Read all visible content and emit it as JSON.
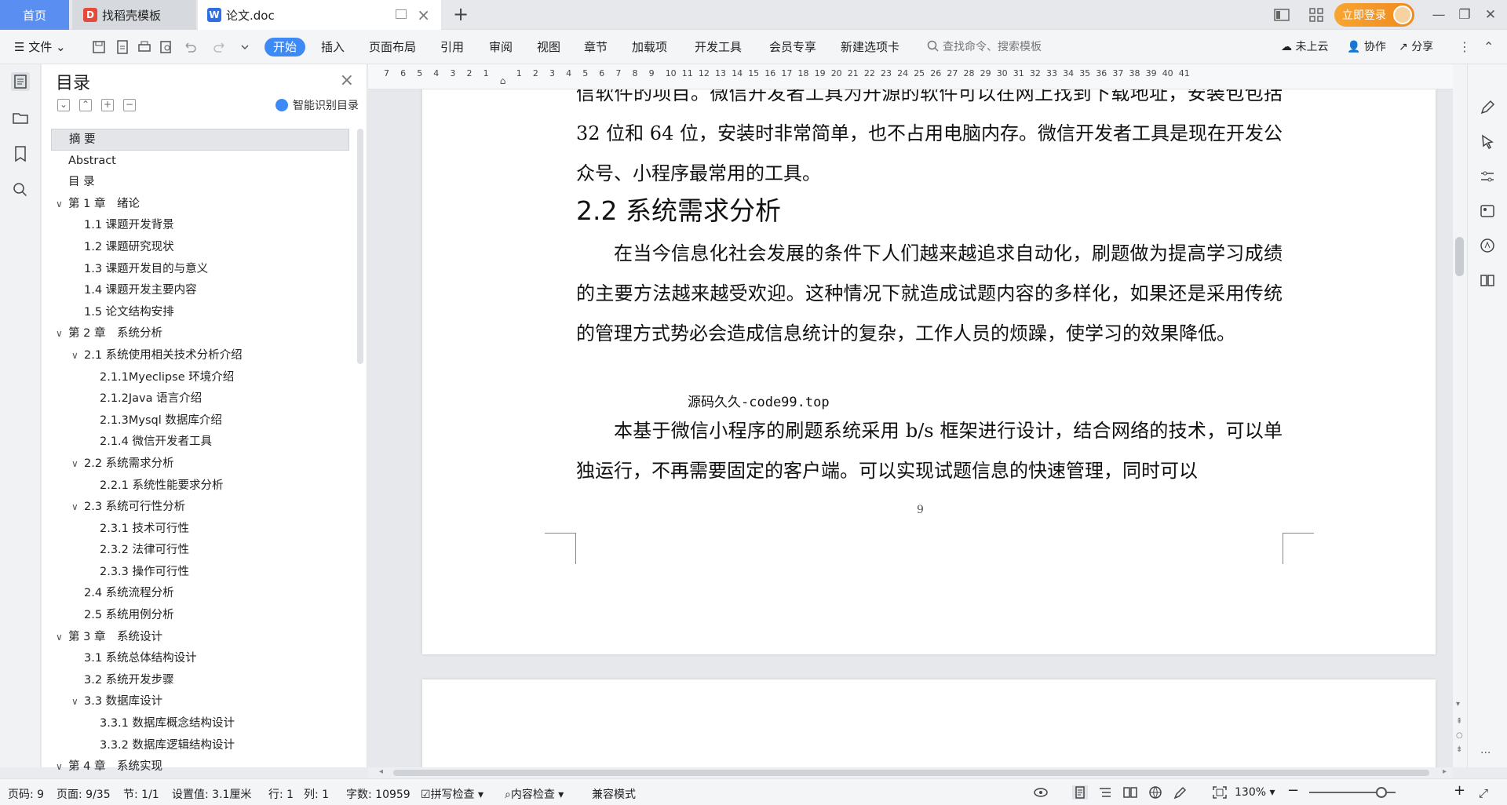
{
  "tabs": {
    "home": "首页",
    "template": "找稻壳模板",
    "doc": "论文.doc"
  },
  "titlebar": {
    "login_label": "立即登录"
  },
  "menubar": {
    "file": "文件",
    "items": [
      "开始",
      "插入",
      "页面布局",
      "引用",
      "审阅",
      "视图",
      "章节",
      "加载项",
      "开发工具",
      "会员专享",
      "新建选项卡"
    ],
    "search_placeholder": "查找命令、搜索模板",
    "cloud": "未上云",
    "collab": "协作",
    "share": "分享"
  },
  "toc": {
    "title": "目录",
    "smart_label": "智能识别目录",
    "items": [
      {
        "text": "摘 要",
        "level": 0,
        "caret": false,
        "selected": true
      },
      {
        "text": "Abstract",
        "level": 0,
        "caret": false
      },
      {
        "text": "目 录",
        "level": 0,
        "caret": false
      },
      {
        "text": "第 1 章　绪论",
        "level": 0,
        "caret": true
      },
      {
        "text": "1.1 课题开发背景",
        "level": 1,
        "caret": false
      },
      {
        "text": "1.2 课题研究现状",
        "level": 1,
        "caret": false
      },
      {
        "text": "1.3 课题开发目的与意义",
        "level": 1,
        "caret": false
      },
      {
        "text": "1.4 课题开发主要内容",
        "level": 1,
        "caret": false
      },
      {
        "text": "1.5 论文结构安排",
        "level": 1,
        "caret": false
      },
      {
        "text": "第 2 章　系统分析",
        "level": 0,
        "caret": true
      },
      {
        "text": "2.1 系统使用相关技术分析介绍",
        "level": 1,
        "caret": true
      },
      {
        "text": "2.1.1Myeclipse 环境介绍",
        "level": 2,
        "caret": false
      },
      {
        "text": "2.1.2Java 语言介绍",
        "level": 2,
        "caret": false
      },
      {
        "text": " 2.1.3Mysql 数据库介绍",
        "level": 2,
        "caret": false
      },
      {
        "text": "2.1.4 微信开发者工具",
        "level": 2,
        "caret": false
      },
      {
        "text": "2.2 系统需求分析",
        "level": 1,
        "caret": true
      },
      {
        "text": "2.2.1 系统性能要求分析",
        "level": 2,
        "caret": false
      },
      {
        "text": "2.3 系统可行性分析",
        "level": 1,
        "caret": true
      },
      {
        "text": "2.3.1 技术可行性",
        "level": 2,
        "caret": false
      },
      {
        "text": "2.3.2 法律可行性",
        "level": 2,
        "caret": false
      },
      {
        "text": "2.3.3 操作可行性",
        "level": 2,
        "caret": false
      },
      {
        "text": "2.4 系统流程分析",
        "level": 1,
        "caret": false
      },
      {
        "text": "2.5 系统用例分析",
        "level": 1,
        "caret": false
      },
      {
        "text": "第 3 章　系统设计",
        "level": 0,
        "caret": true
      },
      {
        "text": "3.1 系统总体结构设计",
        "level": 1,
        "caret": false
      },
      {
        "text": "3.2 系统开发步骤",
        "level": 1,
        "caret": false
      },
      {
        "text": "3.3 数据库设计",
        "level": 1,
        "caret": true
      },
      {
        "text": "3.3.1 数据库概念结构设计",
        "level": 2,
        "caret": false
      },
      {
        "text": "3.3.2 数据库逻辑结构设计",
        "level": 2,
        "caret": false
      },
      {
        "text": "第 4 章　系统实现",
        "level": 0,
        "caret": true
      }
    ]
  },
  "ruler": {
    "numbers": [
      "7",
      "6",
      "5",
      "4",
      "3",
      "2",
      "1",
      "",
      "1",
      "2",
      "3",
      "4",
      "5",
      "6",
      "7",
      "8",
      "9",
      "10",
      "11",
      "12",
      "13",
      "14",
      "15",
      "16",
      "17",
      "18",
      "19",
      "20",
      "21",
      "22",
      "23",
      "24",
      "25",
      "26",
      "27",
      "28",
      "29",
      "30",
      "31",
      "32",
      "33",
      "34",
      "35",
      "36",
      "37",
      "38",
      "39",
      "40",
      "41"
    ]
  },
  "document": {
    "para1": "信软件的项目。微信开发者工具为开源的软件可以在网上找到下载地址，安装包包括 32 位和 64 位，安装时非常简单，也不占用电脑内存。微信开发者工具是现在开发公众号、小程序最常用的工具。",
    "heading": "2.2 系统需求分析",
    "para2": "在当今信息化社会发展的条件下人们越来越追求自动化，刷题做为提高学习成绩的主要方法越来越受欢迎。这种情况下就造成试题内容的多样化，如果还是采用传统的管理方式势必会造成信息统计的复杂，工作人员的烦躁，使学习的效果降低。",
    "watermark": "源码久久-code99.top",
    "para3": "本基于微信小程序的刷题系统采用 b/s 框架进行设计，结合网络的技术，可以单独运行，不再需要固定的客户端。可以实现试题信息的快速管理，同时可以",
    "page_number": "9"
  },
  "statusbar": {
    "page_code": "页码: 9",
    "page": "页面: 9/35",
    "section": "节: 1/1",
    "setting": "设置值: 3.1厘米",
    "row": "行: 1",
    "col": "列: 1",
    "words": "字数: 10959",
    "spell": "拼写检查",
    "content_check": "内容检查",
    "compat": "兼容模式",
    "zoom": "130%"
  },
  "colors": {
    "accent": "#3d8af7",
    "login": "#f0891f"
  }
}
